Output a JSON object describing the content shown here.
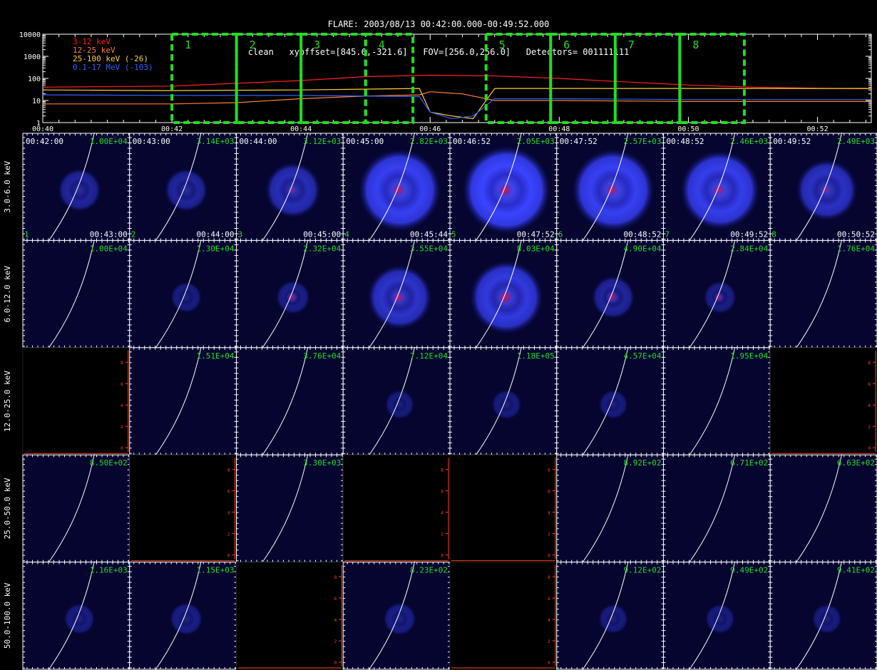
{
  "header": {
    "line1": "FLARE: 2003/08/13 00:42:00.000-00:49:52.000",
    "line2": "clean   xyoffset=[845.6,-321.6]   FOV=[256.0,256.0]   Detectors= 001111111"
  },
  "colors": {
    "background": "#000000",
    "band_3_12": "#ff2020",
    "band_12_25": "#ff8030",
    "band_25_100": "#ffd030",
    "band_gamma": "#3060ff",
    "interval_box": "#22dd22",
    "peak_label": "#22dd22",
    "missing_frame": "#ff4020",
    "limb": "#ffffff",
    "map_background": "#050530"
  },
  "chart_data": [
    {
      "type": "line",
      "x_unit": "time (UT)",
      "xlim": [
        "00:40",
        "00:52:50"
      ],
      "x_tick_labels": [
        "00:40",
        "00:42",
        "00:44",
        "00:46",
        "00:48",
        "00:50",
        "00:52"
      ],
      "y_scale": "log",
      "ylim": [
        1,
        10000
      ],
      "y_tick_labels": [
        "10000",
        "1000",
        "100",
        "10",
        "1"
      ],
      "legend_position": "top-left",
      "series": [
        {
          "name": "3-12 keV",
          "color": "#ff2020",
          "x": [
            "00:40",
            "00:42",
            "00:44",
            "00:45",
            "00:46",
            "00:47",
            "00:48",
            "00:49",
            "00:50",
            "00:51",
            "00:52",
            "00:52:50"
          ],
          "y": [
            40,
            45,
            80,
            120,
            140,
            130,
            100,
            70,
            50,
            40,
            36,
            34
          ]
        },
        {
          "name": "12-25 keV",
          "color": "#ff8030",
          "x": [
            "00:40",
            "00:42",
            "00:43",
            "00:44",
            "00:45",
            "00:45:50",
            "00:46",
            "00:46:30",
            "00:47",
            "00:48",
            "00:50",
            "00:52:50"
          ],
          "y": [
            7,
            7,
            8,
            12,
            16,
            18,
            25,
            20,
            10,
            10,
            9,
            9
          ]
        },
        {
          "name": "25-100 keV (-26)",
          "color": "#ffd030",
          "x": [
            "00:40",
            "00:42",
            "00:44",
            "00:45:50",
            "00:46",
            "00:46:20",
            "00:46:40",
            "00:47",
            "00:48",
            "00:50",
            "00:52:50"
          ],
          "y": [
            30,
            28,
            30,
            35,
            3,
            2,
            1.5,
            35,
            35,
            35,
            35
          ]
        },
        {
          "name": "0.1-17 MeV (-103)",
          "color": "#3060ff",
          "x": [
            "00:40",
            "00:42",
            "00:44",
            "00:45:50",
            "00:46",
            "00:46:20",
            "00:46:40",
            "00:47",
            "00:48",
            "00:50",
            "00:52:50"
          ],
          "y": [
            18,
            17,
            17,
            15,
            3,
            1.5,
            2,
            12,
            12,
            11,
            11
          ]
        }
      ],
      "intervals": [
        {
          "label": "1",
          "start": "00:42:00",
          "end": "00:43:00"
        },
        {
          "label": "2",
          "start": "00:43:00",
          "end": "00:44:00"
        },
        {
          "label": "3",
          "start": "00:44:00",
          "end": "00:45:00"
        },
        {
          "label": "4",
          "start": "00:45:00",
          "end": "00:45:44"
        },
        {
          "label": "5",
          "start": "00:46:52",
          "end": "00:47:52"
        },
        {
          "label": "6",
          "start": "00:47:52",
          "end": "00:48:52"
        },
        {
          "label": "7",
          "start": "00:48:52",
          "end": "00:49:52"
        },
        {
          "label": "8",
          "start": "00:49:52",
          "end": "00:50:52"
        }
      ]
    },
    {
      "type": "heatmap",
      "description_columns": "time intervals",
      "energy_bands": [
        "3.0-6.0 keV",
        "6.0-12.0 keV",
        "12.0-25.0 keV",
        "25.0-50.0 keV",
        "50.0-100.0 keV"
      ],
      "columns": [
        {
          "index": "1",
          "start": "00:42:00",
          "end": "00:43:00"
        },
        {
          "index": "2",
          "start": "00:43:00",
          "end": "00:44:00"
        },
        {
          "index": "3",
          "start": "00:44:00",
          "end": "00:45:00"
        },
        {
          "index": "4",
          "start": "00:45:00",
          "end": "00:45:44"
        },
        {
          "index": "5",
          "start": "00:46:52",
          "end": "00:47:52"
        },
        {
          "index": "6",
          "start": "00:47:52",
          "end": "00:48:52"
        },
        {
          "index": "7",
          "start": "00:48:52",
          "end": "00:49:52"
        },
        {
          "index": "8",
          "start": "00:49:52",
          "end": "00:50:52"
        }
      ],
      "peaks": [
        [
          "1.00E+04",
          "3.14E+03",
          "3.12E+03",
          "2.82E+03",
          "2.05E+03",
          "2.57E+03",
          "2.46E+03",
          "2.49E+03"
        ],
        [
          "1.00E+04",
          "1.30E+04",
          "2.32E+04",
          "3.55E+04",
          "8.03E+04",
          "4.90E+04",
          "2.84E+04",
          "1.76E+04"
        ],
        [
          "",
          "1.51E+04",
          "3.76E+04",
          "7.12E+04",
          "1.18E+05",
          "4.57E+04",
          "1.95E+04",
          ""
        ],
        [
          "8.50E+02",
          "",
          "3.30E+03",
          "",
          "",
          "8.92E+02",
          "6.71E+02",
          "6.63E+02"
        ],
        [
          "1.16E+03",
          "1.15E+03",
          "",
          "8.23E+02",
          "",
          "9.12E+02",
          "9.49E+02",
          "9.41E+02"
        ]
      ],
      "halo_level": [
        [
          0.25,
          0.25,
          0.45,
          0.9,
          1.0,
          0.9,
          0.85,
          0.55
        ],
        [
          0,
          0.05,
          0.1,
          0.6,
          0.75,
          0.25,
          0.08,
          0
        ],
        [
          0,
          0,
          0,
          0.02,
          0.03,
          0.02,
          0,
          0
        ],
        [
          0,
          0,
          0,
          0,
          0,
          0,
          0,
          0
        ],
        [
          0.05,
          0.08,
          0,
          0.08,
          0,
          0.03,
          0.03,
          0.03
        ]
      ],
      "core_level": [
        [
          0,
          0,
          0.3,
          0.9,
          1.0,
          0.9,
          0.8,
          0.4
        ],
        [
          0,
          0,
          0.5,
          0.8,
          1.0,
          0.6,
          0.4,
          0
        ],
        [
          0,
          0,
          0,
          0,
          0,
          0,
          0,
          0
        ],
        [
          0,
          0,
          0,
          0,
          0,
          0,
          0,
          0
        ],
        [
          0,
          0,
          0,
          0,
          0,
          0,
          0,
          0
        ]
      ],
      "missing": [
        [
          false,
          false,
          false,
          false,
          false,
          false,
          false,
          false
        ],
        [
          false,
          false,
          false,
          false,
          false,
          false,
          false,
          false
        ],
        [
          true,
          false,
          false,
          false,
          false,
          false,
          false,
          true
        ],
        [
          false,
          true,
          false,
          true,
          true,
          false,
          false,
          false
        ],
        [
          false,
          false,
          true,
          false,
          true,
          false,
          false,
          false
        ]
      ],
      "axis_tick_labels": [
        "0",
        "2",
        "4",
        "6",
        "8"
      ]
    }
  ]
}
